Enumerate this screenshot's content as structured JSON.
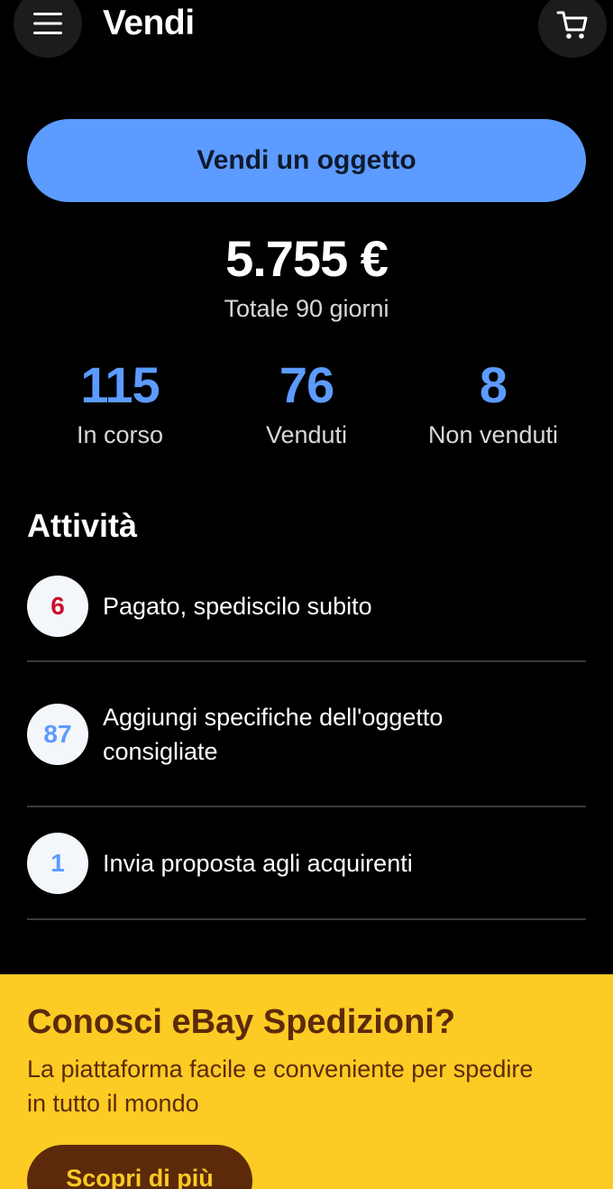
{
  "header": {
    "title": "Vendi",
    "menu_icon": "hamburger-menu-icon",
    "cart_icon": "shopping-cart-icon"
  },
  "sell_button_label": "Vendi un oggetto",
  "summary": {
    "total_amount": "5.755 €",
    "total_label": "Totale 90 giorni"
  },
  "stats": [
    {
      "value": "115",
      "label": "In corso"
    },
    {
      "value": "76",
      "label": "Venduti"
    },
    {
      "value": "8",
      "label": "Non venduti"
    }
  ],
  "activities": {
    "title": "Attività",
    "items": [
      {
        "count": "6",
        "text": "Pagato, spediscilo subito",
        "count_color": "#c8102e"
      },
      {
        "count": "87",
        "text_line1": "Aggiungi specifiche dell'oggetto",
        "text_line2": "consigliate",
        "count_color": "#5c9bff"
      },
      {
        "count": "1",
        "text": "Invia proposta agli acquirenti",
        "count_color": "#5c9bff"
      }
    ]
  },
  "promo": {
    "title": "Conosci eBay Spedizioni?",
    "text_line1": "La piattaforma facile e conveniente per spedire",
    "text_line2": "in tutto il mondo",
    "button_label": "Scopri di più"
  },
  "colors": {
    "accent": "#5c9bff",
    "promo_background": "#fccb24",
    "promo_text": "#5c2a0a"
  }
}
